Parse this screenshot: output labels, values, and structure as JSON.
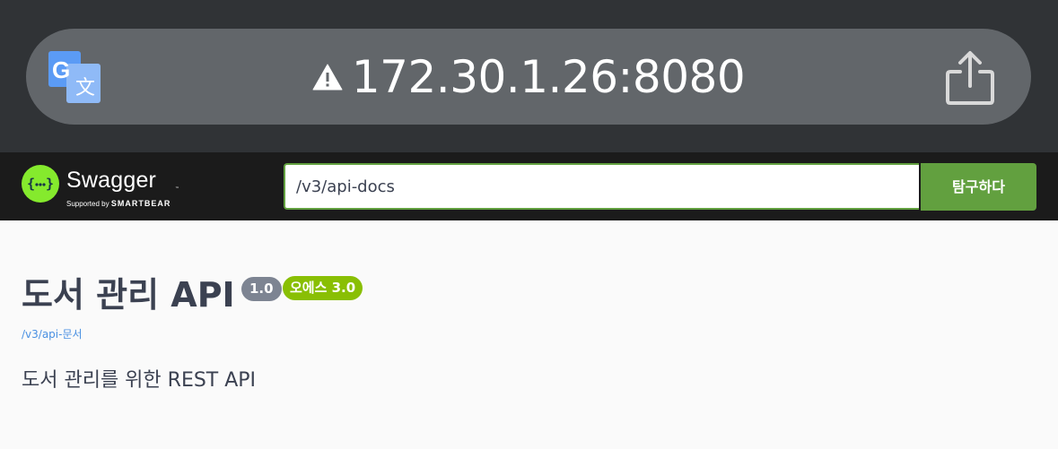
{
  "browser": {
    "url": "172.30.1.26:8080",
    "icons": [
      "translate-icon",
      "warning-icon",
      "share-icon"
    ]
  },
  "topbar": {
    "logo_name": "Swagger",
    "logo_tm": "™",
    "logo_supported_prefix": "Supported by",
    "logo_supported_brand": "SMARTBEAR",
    "spec_url": "/v3/api-docs",
    "explore_label": "탐구하다"
  },
  "info": {
    "title": "도서 관리 API",
    "version": "1.0",
    "oas": "오에스 3.0",
    "spec_link": "/v3/api-문서",
    "description": "도서 관리를 위한 REST API"
  },
  "colors": {
    "chrome_bg": "#303336",
    "address_bar": "#62666a",
    "topbar_bg": "#1b1b1b",
    "swagger_green": "#85ea2d",
    "explore_green": "#62a03f",
    "version_badge": "#7d8492",
    "oas_badge": "#89bf04",
    "link_blue": "#4990e2",
    "text_dark": "#3b4151"
  }
}
